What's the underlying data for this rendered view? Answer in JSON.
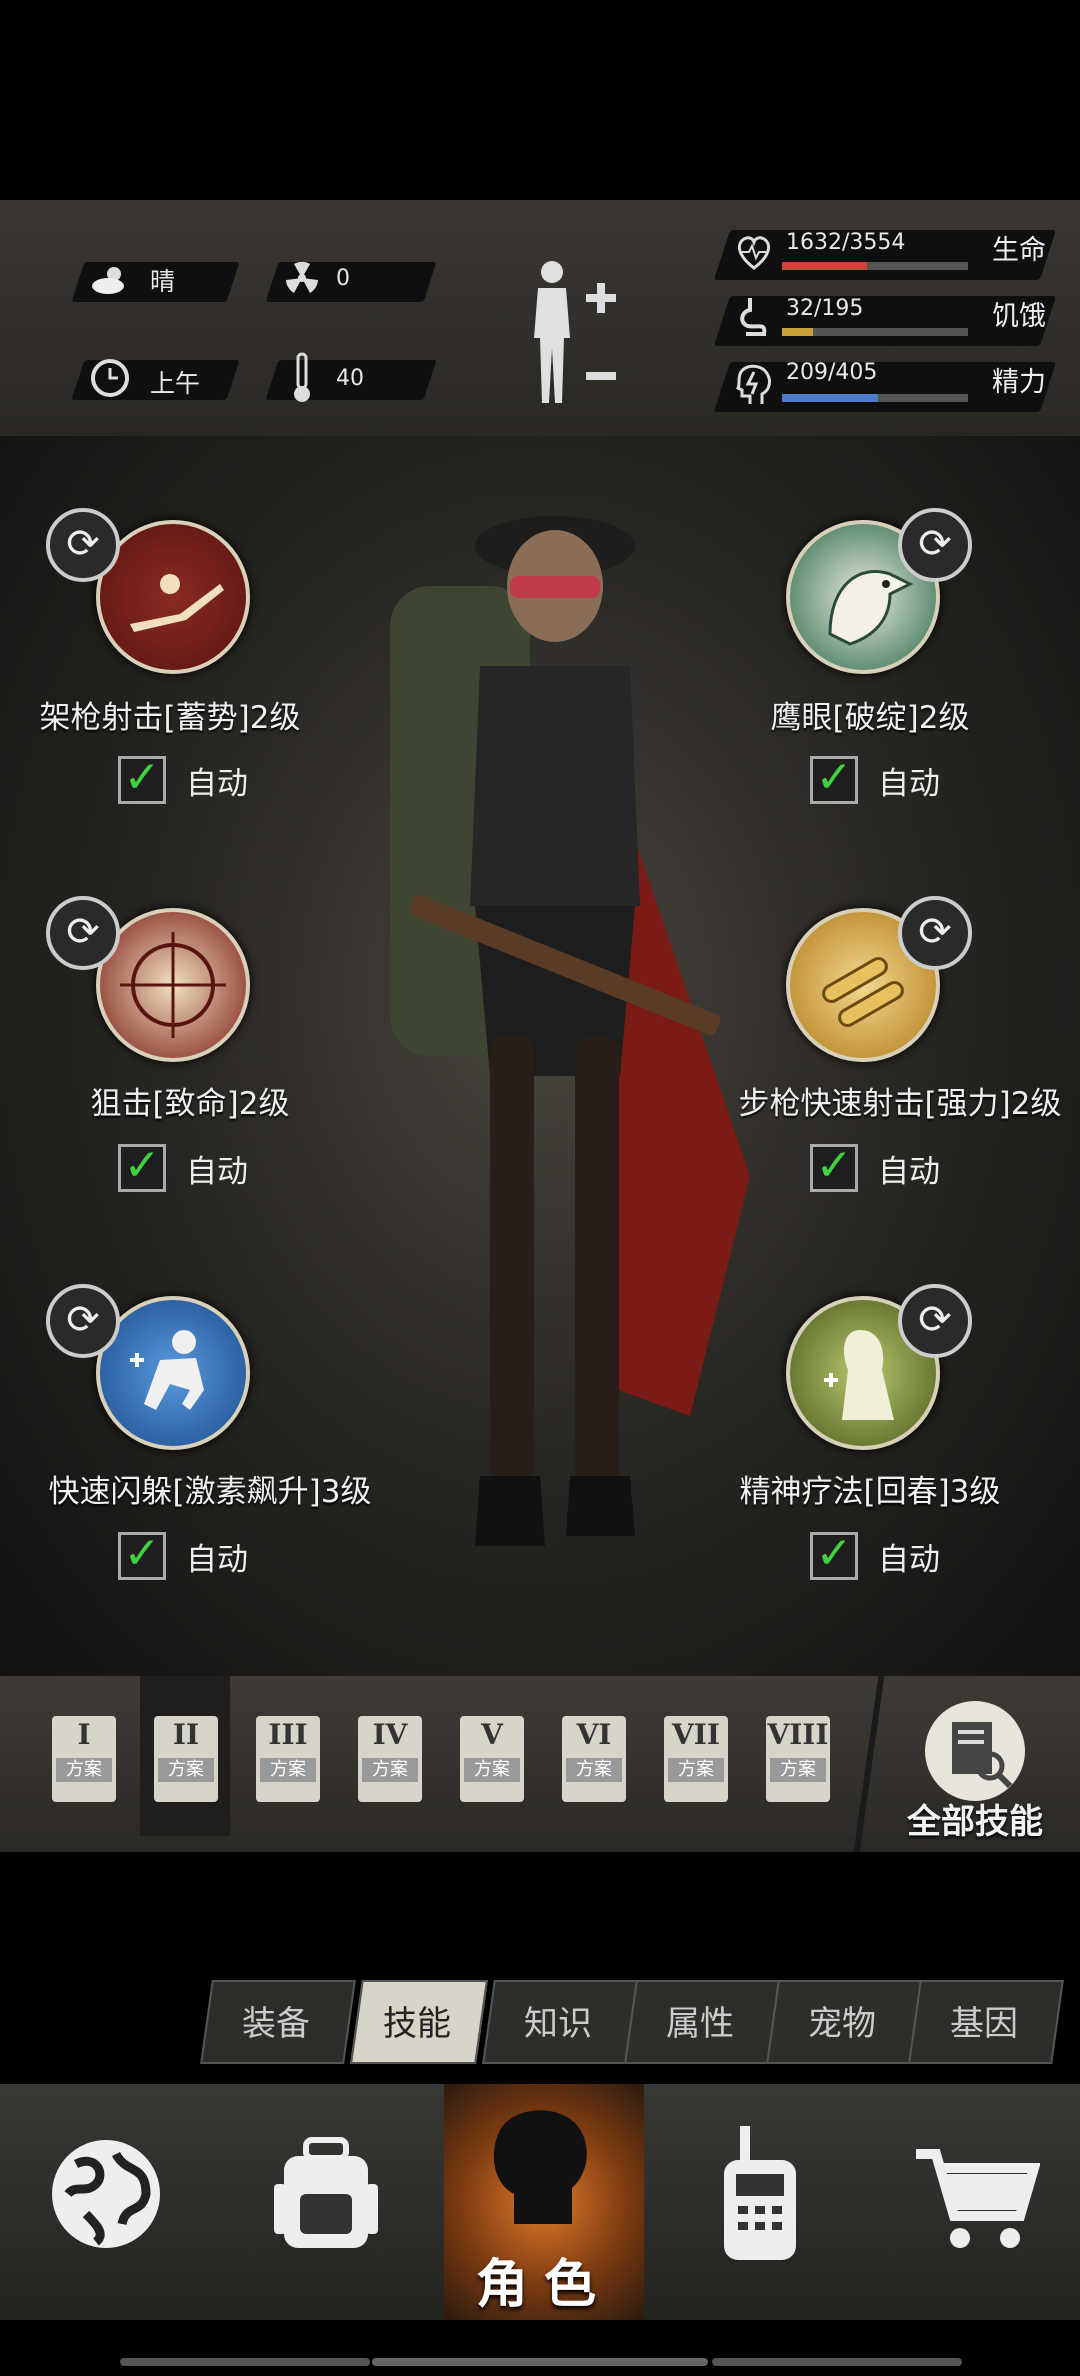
{
  "hud": {
    "weather": {
      "icon": "cloud-sun-icon",
      "label": "晴"
    },
    "radiation": {
      "icon": "radiation-icon",
      "value": "0"
    },
    "time": {
      "icon": "clock-icon",
      "label": "上午"
    },
    "temperature": {
      "icon": "thermometer-icon",
      "value": "40"
    },
    "health": {
      "icon": "heart-icon",
      "value": "1632/3554",
      "label": "生命",
      "fraction": 0.459,
      "color": "#c9483a"
    },
    "hunger": {
      "icon": "stomach-icon",
      "value": "32/195",
      "label": "饥饿",
      "fraction": 0.164,
      "color": "#c9a23a"
    },
    "energy": {
      "icon": "head-bolt-icon",
      "value": "209/405",
      "label": "精力",
      "fraction": 0.516,
      "color": "#4a7cc9"
    }
  },
  "skills": [
    {
      "name": "架枪射击[蓄势]2级",
      "auto_label": "自动",
      "auto": true,
      "icon": "prone-rifle-icon"
    },
    {
      "name": "鹰眼[破绽]2级",
      "auto_label": "自动",
      "auto": true,
      "icon": "eagle-icon"
    },
    {
      "name": "狙击[致命]2级",
      "auto_label": "自动",
      "auto": true,
      "icon": "crosshair-icon"
    },
    {
      "name": "步枪快速射击[强力]2级",
      "auto_label": "自动",
      "auto": true,
      "icon": "bullets-icon"
    },
    {
      "name": "快速闪躲[激素飙升]3级",
      "auto_label": "自动",
      "auto": true,
      "icon": "dodge-icon"
    },
    {
      "name": "精神疗法[回春]3级",
      "auto_label": "自动",
      "auto": true,
      "icon": "spirit-heal-icon"
    }
  ],
  "plans": [
    {
      "roman": "I",
      "label": "方案"
    },
    {
      "roman": "II",
      "label": "方案"
    },
    {
      "roman": "III",
      "label": "方案"
    },
    {
      "roman": "IV",
      "label": "方案"
    },
    {
      "roman": "V",
      "label": "方案"
    },
    {
      "roman": "VI",
      "label": "方案"
    },
    {
      "roman": "VII",
      "label": "方案"
    },
    {
      "roman": "VIII",
      "label": "方案"
    }
  ],
  "all_skills_label": "全部技能",
  "tabs": [
    "装备",
    "技能",
    "知识",
    "属性",
    "宠物",
    "基因"
  ],
  "active_tab": "技能",
  "nav": {
    "world": "globe-icon",
    "backpack": "backpack-icon",
    "character_label": "角色",
    "radio": "walkie-talkie-icon",
    "shop": "cart-icon"
  }
}
